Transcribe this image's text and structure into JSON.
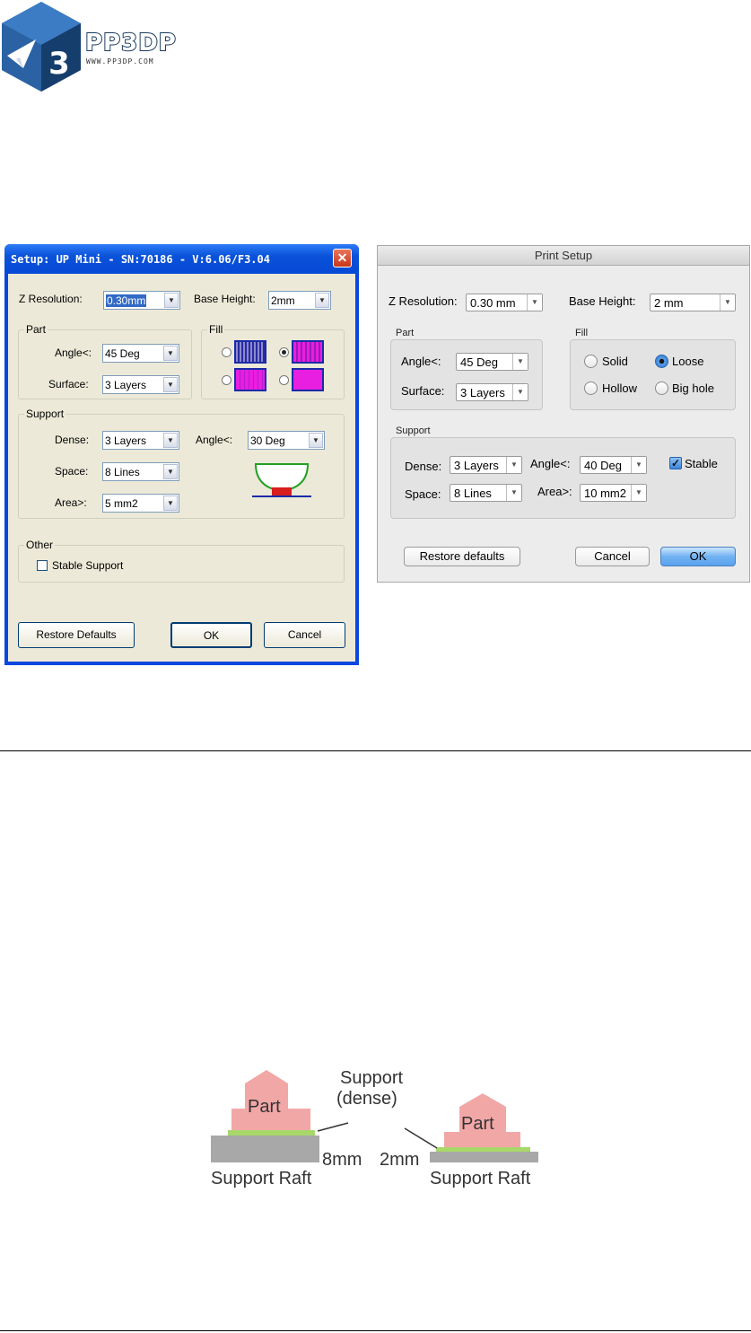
{
  "logo": {
    "badge": "3",
    "name": "PP3DP",
    "url": "WWW.PP3DP.COM"
  },
  "colors": {
    "xp_title": "#0a52d8",
    "xp_face": "#ece9d8",
    "fill_magenta": "#e81ee0",
    "fill_blue": "#1a2aa8",
    "part_pink": "#f2a7a7",
    "support_green": "#a8d86a",
    "raft_gray": "#a8a8a8"
  },
  "win_dialog": {
    "title": "Setup: UP Mini - SN:70186 - V:6.06/F3.04",
    "close_icon": "close-icon",
    "z_resolution": {
      "label": "Z Resolution:",
      "value": "0.30mm"
    },
    "base_height": {
      "label": "Base Height:",
      "value": "2mm"
    },
    "part": {
      "label": "Part",
      "angle_label": "Angle<:",
      "angle_value": "45 Deg",
      "surface_label": "Surface:",
      "surface_value": "3 Layers"
    },
    "fill": {
      "label": "Fill",
      "selected_index": 1
    },
    "support": {
      "label": "Support",
      "dense_label": "Dense:",
      "dense_value": "3 Layers",
      "space_label": "Space:",
      "space_value": "8 Lines",
      "area_label": "Area>:",
      "area_value": "5 mm2",
      "angle_label": "Angle<:",
      "angle_value": "30 Deg"
    },
    "other": {
      "label": "Other",
      "stable_support": "Stable Support"
    },
    "buttons": {
      "restore": "Restore Defaults",
      "ok": "OK",
      "cancel": "Cancel"
    }
  },
  "mac_dialog": {
    "title": "Print Setup",
    "z_resolution": {
      "label": "Z Resolution:",
      "value": "0.30 mm"
    },
    "base_height": {
      "label": "Base Height:",
      "value": "2 mm"
    },
    "part": {
      "label": "Part",
      "angle_label": "Angle<:",
      "angle_value": "45 Deg",
      "surface_label": "Surface:",
      "surface_value": "3 Layers"
    },
    "fill": {
      "label": "Fill",
      "options": [
        "Solid",
        "Loose",
        "Hollow",
        "Big hole"
      ],
      "selected": "Loose"
    },
    "support": {
      "label": "Support",
      "dense_label": "Dense:",
      "dense_value": "3 Layers",
      "space_label": "Space:",
      "space_value": "8 Lines",
      "angle_label": "Angle<:",
      "angle_value": "40 Deg",
      "area_label": "Area>:",
      "area_value": "10 mm2",
      "stable_label": "Stable",
      "stable_checked": true
    },
    "buttons": {
      "restore": "Restore defaults",
      "cancel": "Cancel",
      "ok": "OK"
    }
  },
  "diagram": {
    "left": {
      "part": "Part",
      "support_label_1": "Support",
      "support_label_2": "(dense)",
      "raft_height": "8mm",
      "raft_label": "Support Raft"
    },
    "right": {
      "part": "Part",
      "raft_height": "2mm",
      "raft_label": "Support Raft"
    }
  }
}
